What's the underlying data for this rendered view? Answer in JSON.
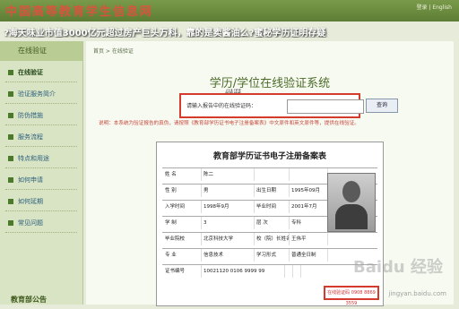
{
  "topbar": {
    "logo": "中国高等教育学生信息网",
    "links": "登录 | English"
  },
  "headline": "?海天味业市值3000亿元超过房产巨头万科，靠的是卖酱油么?蜜秘学历证明存疑",
  "sidebar": {
    "title": "在线验证",
    "items": [
      {
        "label": "在线验证"
      },
      {
        "label": "验证服务简介"
      },
      {
        "label": "防伪措施"
      },
      {
        "label": "服务流程"
      },
      {
        "label": "特点和用途"
      },
      {
        "label": "如何申请"
      },
      {
        "label": "如何延期"
      },
      {
        "label": "常见问题"
      }
    ],
    "footer": "教育部公告"
  },
  "content": {
    "breadcrumb": "首页 > 在线验证",
    "title": "学历/学位在线验证系统",
    "overlay_text": "學歷",
    "verify_label": "请输入报告中的在线验证码：",
    "verify_button": "查询",
    "note": "说明：本系统为验证报告的真伪，请按照《教育部学历证书电子注册备案表》中文原件和英文原件等，提供在线验证。",
    "cert_title": "教育部学历证书电子注册备案表",
    "cert_rows": [
      [
        "姓  名",
        "陈二",
        "",
        ""
      ],
      [
        "性  别",
        "男",
        "出生日期",
        "1995年09月"
      ],
      [
        "入学时间",
        "1998年9月",
        "毕业时间",
        "2001年7月"
      ],
      [
        "学  制",
        "3",
        "层  次",
        "专科"
      ],
      [
        "毕业院校",
        "北京科技大学",
        "校（院）长姓名",
        "王伟平"
      ],
      [
        "专  业",
        "信息技术",
        "学习形式",
        "普通全日制"
      ],
      [
        "证书编号",
        "10021120 0106 9999 99",
        "",
        ""
      ]
    ],
    "cert_number_label": "在线验证码 0908 8869 3559",
    "watermark": "Baidu 经验",
    "watermark_url": "jingyan.baidu.com"
  }
}
